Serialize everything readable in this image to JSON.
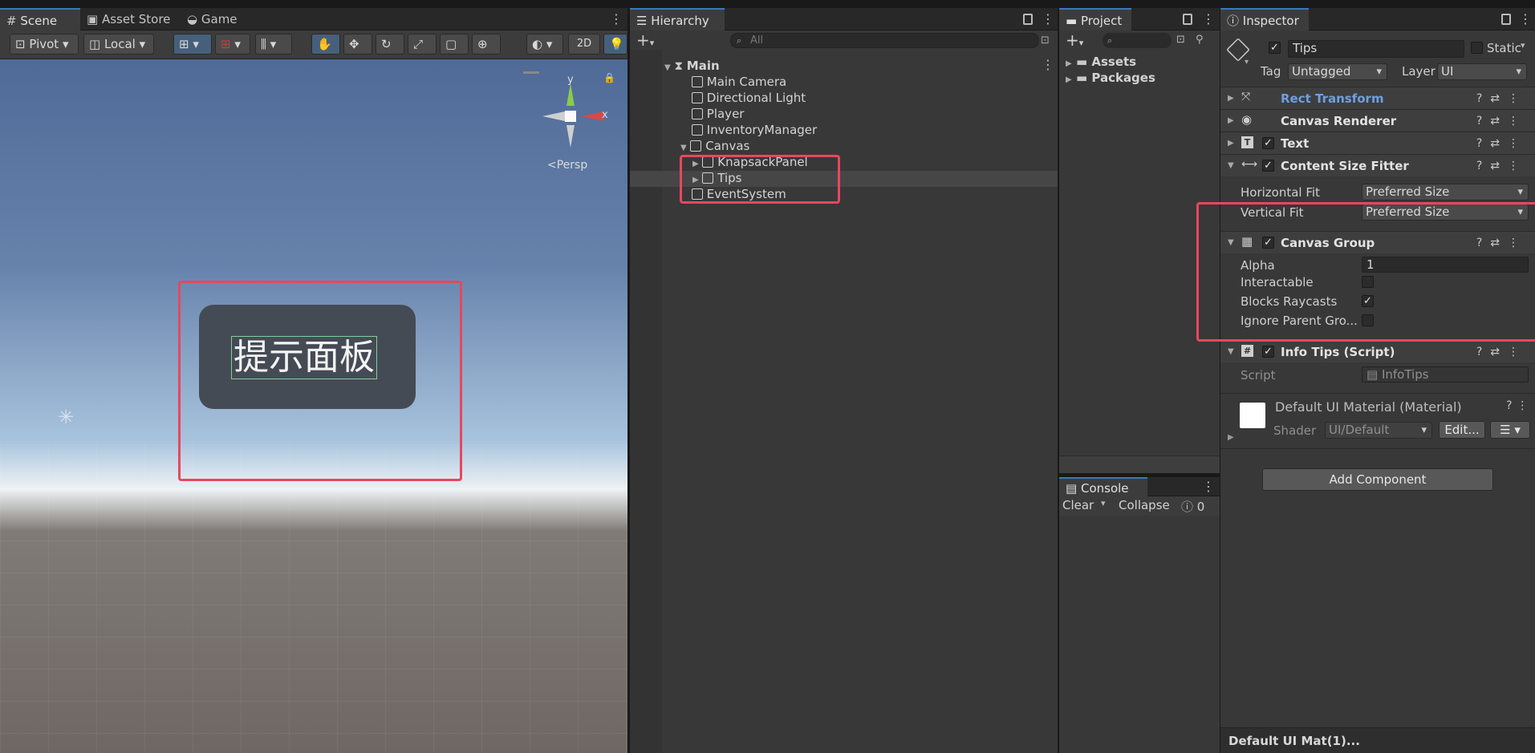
{
  "scene": {
    "tabs": [
      "Scene",
      "Asset Store",
      "Game"
    ],
    "toolbar": {
      "pivot": "Pivot",
      "local": "Local",
      "mode_2d": "2D"
    },
    "gizmo": {
      "x": "x",
      "y": "y",
      "persp": "<Persp"
    },
    "panel_text": "提示面板"
  },
  "hierarchy": {
    "tab": "Hierarchy",
    "search_placeholder": "All",
    "scene_name": "Main",
    "items": [
      "Main Camera",
      "Directional Light",
      "Player",
      "InventoryManager",
      "Canvas",
      "KnapsackPanel",
      "Tips",
      "EventSystem"
    ]
  },
  "project": {
    "tab": "Project",
    "folders": [
      "Assets",
      "Packages"
    ]
  },
  "console": {
    "tab": "Console",
    "clear": "Clear",
    "collapse": "Collapse",
    "count": "0"
  },
  "inspector": {
    "tab": "Inspector",
    "object_name": "Tips",
    "static_label": "Static",
    "tag_label": "Tag",
    "tag_value": "Untagged",
    "layer_label": "Layer",
    "layer_value": "UI",
    "components": {
      "rect_transform": "Rect Transform",
      "canvas_renderer": "Canvas Renderer",
      "text": "Text",
      "content_size_fitter": "Content Size Fitter",
      "canvas_group": "Canvas Group",
      "info_tips": "Info Tips (Script)"
    },
    "fitter": {
      "horizontal_label": "Horizontal Fit",
      "horizontal_value": "Preferred Size",
      "vertical_label": "Vertical Fit",
      "vertical_value": "Preferred Size"
    },
    "canvas_group": {
      "alpha_label": "Alpha",
      "alpha_value": "1",
      "interactable_label": "Interactable",
      "blocks_label": "Blocks Raycasts",
      "ignore_label": "Ignore Parent Gro..."
    },
    "script": {
      "label": "Script",
      "value": "InfoTips"
    },
    "material": {
      "name": "Default UI Material (Material)",
      "shader_label": "Shader",
      "shader_value": "UI/Default",
      "edit": "Edit..."
    },
    "add_component": "Add Component",
    "footer": "Default UI Mat(1)..."
  }
}
